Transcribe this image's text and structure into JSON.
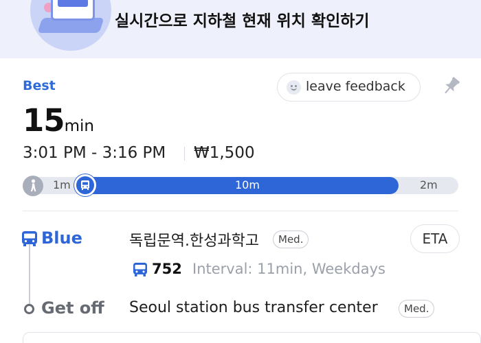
{
  "banner": {
    "subtitle": "",
    "title": "실시간으로 지하철 현재 위치 확인하기"
  },
  "route": {
    "best_label": "Best",
    "feedback_label": "leave feedback",
    "duration_value": "15",
    "duration_unit": "min",
    "time_range": "3:01 PM - 3:16 PM",
    "fare": "₩1,500",
    "segments": {
      "walk_start": "1m",
      "bus": "10m",
      "walk_end": "2m"
    }
  },
  "steps": {
    "board": {
      "line_label": "Blue",
      "stop_name": "독립문역.한성과학고",
      "crowd_badge": "Med.",
      "eta_button": "ETA",
      "route_number": "752",
      "interval_text": "Interval: 11min, Weekdays"
    },
    "get_off": {
      "label": "Get off",
      "stop_name": "Seoul station bus transfer center",
      "crowd_badge": "Med."
    }
  },
  "colors": {
    "accent": "#2e66d8",
    "best": "#2e6bd9",
    "banner_bg": "#eef1fb",
    "muted": "#9aa0aa"
  },
  "icons": [
    "subway-illustration",
    "smile-icon",
    "pin-icon",
    "walk-icon",
    "bus-icon"
  ]
}
